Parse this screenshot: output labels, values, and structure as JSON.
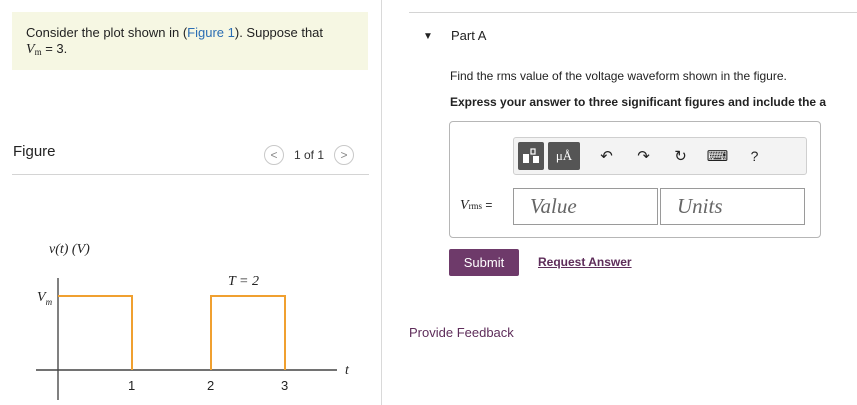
{
  "problem": {
    "text_before": "Consider the plot shown in (",
    "figure_link": "Figure 1",
    "text_after": "). Suppose that",
    "var_main": "V",
    "var_sub": "m",
    "var_rest": " = 3."
  },
  "figure": {
    "title": "Figure",
    "pager_text": "1 of 1",
    "prev_label": "<",
    "next_label": ">"
  },
  "plot": {
    "y_label": "v(t) (V)",
    "vm_main": "V",
    "vm_sub": "m",
    "period_label": "T = 2",
    "t_label": "t",
    "x_ticks": [
      "1",
      "2",
      "3"
    ],
    "waveform_color": "#f0a030"
  },
  "part": {
    "caret": "▼",
    "title": "Part A",
    "question": "Find the rms value of the voltage waveform shown in the figure.",
    "instruction": "Express your answer to three significant figures and include the a"
  },
  "toolbar": {
    "template_icon": "templates-icon",
    "mu_a": "μÅ",
    "undo": "↶",
    "redo": "↷",
    "reset": "↻",
    "keyboard": "⌨",
    "help": "?"
  },
  "answer": {
    "label_main": "V",
    "label_sub": "rms",
    "label_eq": " =",
    "value_placeholder": "Value",
    "units_placeholder": "Units"
  },
  "actions": {
    "submit": "Submit",
    "request": "Request Answer",
    "feedback": "Provide Feedback"
  }
}
